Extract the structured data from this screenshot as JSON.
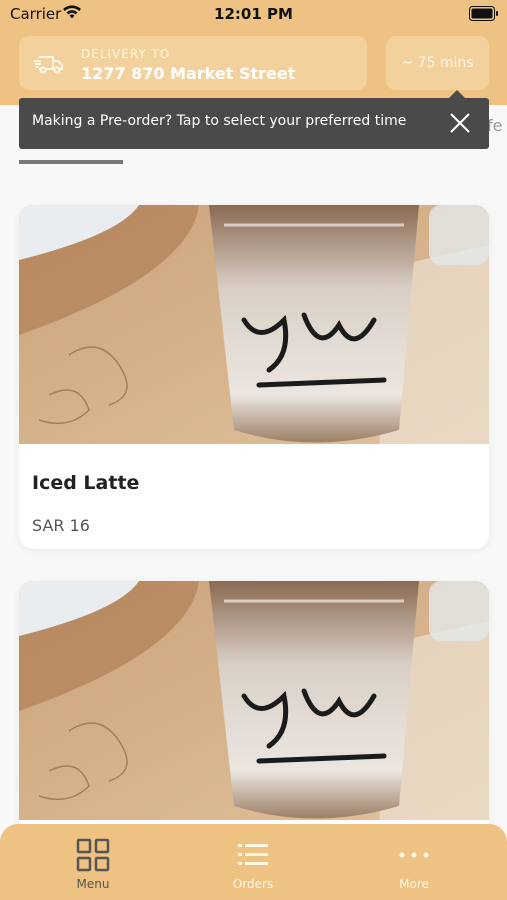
{
  "status_bar": {
    "carrier": "Carrier",
    "time": "12:01 PM"
  },
  "header": {
    "delivery_label": "DELIVERY TO",
    "address": "1277 870 Market Street",
    "eta": "~ 75 mins",
    "icon": "truck-icon"
  },
  "tooltip": {
    "message": "Making a Pre-order? Tap to select your preferred time",
    "close_icon": "close-icon"
  },
  "category_tabs": {
    "peek_text": "fe"
  },
  "products": [
    {
      "name": "Iced Latte",
      "price": "SAR 16"
    },
    {
      "name": "",
      "price": ""
    }
  ],
  "bottom_nav": {
    "items": [
      {
        "label": "Menu",
        "icon": "grid-icon",
        "active": true
      },
      {
        "label": "Orders",
        "icon": "list-icon",
        "active": false
      },
      {
        "label": "More",
        "icon": "more-dots-icon",
        "active": false
      }
    ]
  },
  "colors": {
    "brand": "#eec282",
    "brand_light": "#f3d19c",
    "tooltip_bg": "#4a4a4a"
  }
}
